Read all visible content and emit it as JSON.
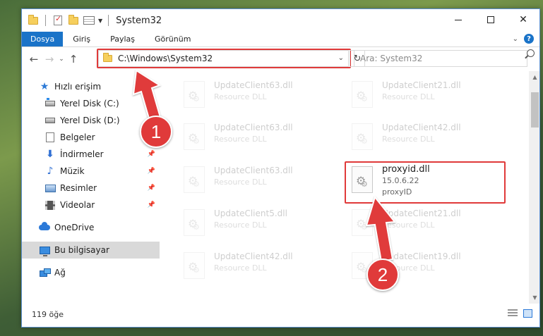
{
  "window": {
    "title": "System32"
  },
  "ribbon": {
    "tabs": [
      {
        "label": "Dosya",
        "active": true
      },
      {
        "label": "Giriş"
      },
      {
        "label": "Paylaş"
      },
      {
        "label": "Görünüm"
      }
    ]
  },
  "nav": {
    "address": "C:\\Windows\\System32",
    "search_placeholder": "Ara: System32"
  },
  "sidebar": {
    "items": [
      {
        "label": "Hızlı erişim",
        "icon": "star-icon"
      },
      {
        "label": "Yerel Disk (C:)",
        "icon": "drive-c-icon",
        "pinned": true
      },
      {
        "label": "Yerel Disk (D:)",
        "icon": "drive-d-icon",
        "pinned": true
      },
      {
        "label": "Belgeler",
        "icon": "documents-icon",
        "pinned": true
      },
      {
        "label": "İndirmeler",
        "icon": "downloads-icon",
        "pinned": true
      },
      {
        "label": "Müzik",
        "icon": "music-icon",
        "pinned": true
      },
      {
        "label": "Resimler",
        "icon": "pictures-icon",
        "pinned": true
      },
      {
        "label": "Videolar",
        "icon": "videos-icon",
        "pinned": true
      },
      {
        "label": "OneDrive",
        "icon": "onedrive-icon"
      },
      {
        "label": "Bu bilgisayar",
        "icon": "this-pc-icon",
        "selected": true
      },
      {
        "label": "Ağ",
        "icon": "network-icon"
      }
    ]
  },
  "files": [
    {
      "name": "UpdateClient63.dll",
      "type": "Resource DLL"
    },
    {
      "name": "UpdateClient21.dll",
      "type": "Resource DLL"
    },
    {
      "name": "UpdateClient63.dll",
      "type": "Resource DLL"
    },
    {
      "name": "UpdateClient42.dll",
      "type": "Resource DLL"
    },
    {
      "name": "UpdateClient63.dll",
      "type": "Resource DLL"
    },
    {
      "name": "proxyid.dll",
      "version": "15.0.6.22",
      "type": "proxyID"
    },
    {
      "name": "UpdateClient5.dll",
      "type": "Resource DLL"
    },
    {
      "name": "UpdateClient21.dll",
      "type": "Resource DLL"
    },
    {
      "name": "UpdateClient42.dll",
      "type": "Resource DLL"
    },
    {
      "name": "UpdateClient19.dll",
      "type": "Resource DLL"
    }
  ],
  "status": {
    "count": "119 öğe"
  },
  "annotations": {
    "step1": "1",
    "step2": "2"
  },
  "colors": {
    "accent": "#1a73c8",
    "highlight": "#e03a3a"
  }
}
